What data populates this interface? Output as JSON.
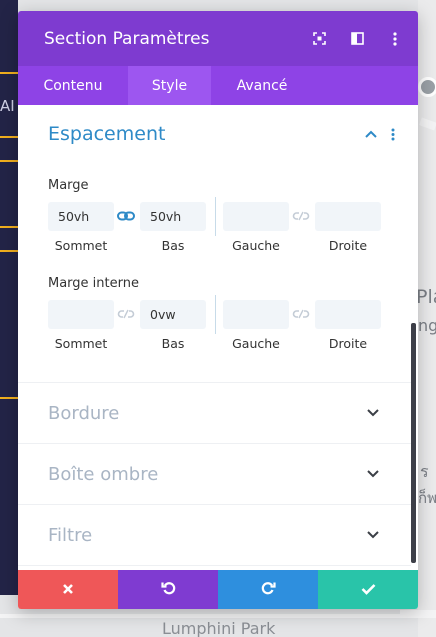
{
  "background": {
    "sidebar_text": "AI",
    "map_labels": [
      "Pla",
      "ng",
      "ร",
      "ก็พ",
      "Lumphini Park"
    ]
  },
  "modal": {
    "title": "Section Paramètres",
    "header_icons": [
      "fullscreen-icon",
      "split-layout-icon",
      "more-vertical-icon"
    ],
    "tabs": [
      {
        "label": "Contenu",
        "active": false
      },
      {
        "label": "Style",
        "active": true
      },
      {
        "label": "Avancé",
        "active": false
      }
    ],
    "section": {
      "title": "Espacement",
      "groups": [
        {
          "label": "Marge",
          "fields": [
            {
              "value": "50vh",
              "caption": "Sommet"
            },
            {
              "value": "50vh",
              "caption": "Bas"
            },
            {
              "value": "",
              "caption": "Gauche"
            },
            {
              "value": "",
              "caption": "Droite"
            }
          ],
          "linked_vertical": true,
          "linked_horizontal": false
        },
        {
          "label": "Marge interne",
          "fields": [
            {
              "value": "",
              "caption": "Sommet"
            },
            {
              "value": "0vw",
              "caption": "Bas"
            },
            {
              "value": "",
              "caption": "Gauche"
            },
            {
              "value": "",
              "caption": "Droite"
            }
          ],
          "linked_vertical": false,
          "linked_horizontal": false
        }
      ]
    },
    "collapsed_sections": [
      "Bordure",
      "Boîte ombre",
      "Filtre"
    ],
    "footer_buttons": [
      {
        "name": "cancel",
        "icon": "close-icon",
        "color": "#ef5758"
      },
      {
        "name": "undo",
        "icon": "undo-icon",
        "color": "#7f3bd1"
      },
      {
        "name": "redo",
        "icon": "redo-icon",
        "color": "#2e8fde"
      },
      {
        "name": "save",
        "icon": "check-icon",
        "color": "#29c4a9"
      }
    ]
  },
  "colors": {
    "header": "#7e3bd0",
    "tabs": "#8e43e6",
    "active_tab": "#9d56f0",
    "section_title": "#2e8ac7",
    "link_active": "#2e8ac7"
  }
}
